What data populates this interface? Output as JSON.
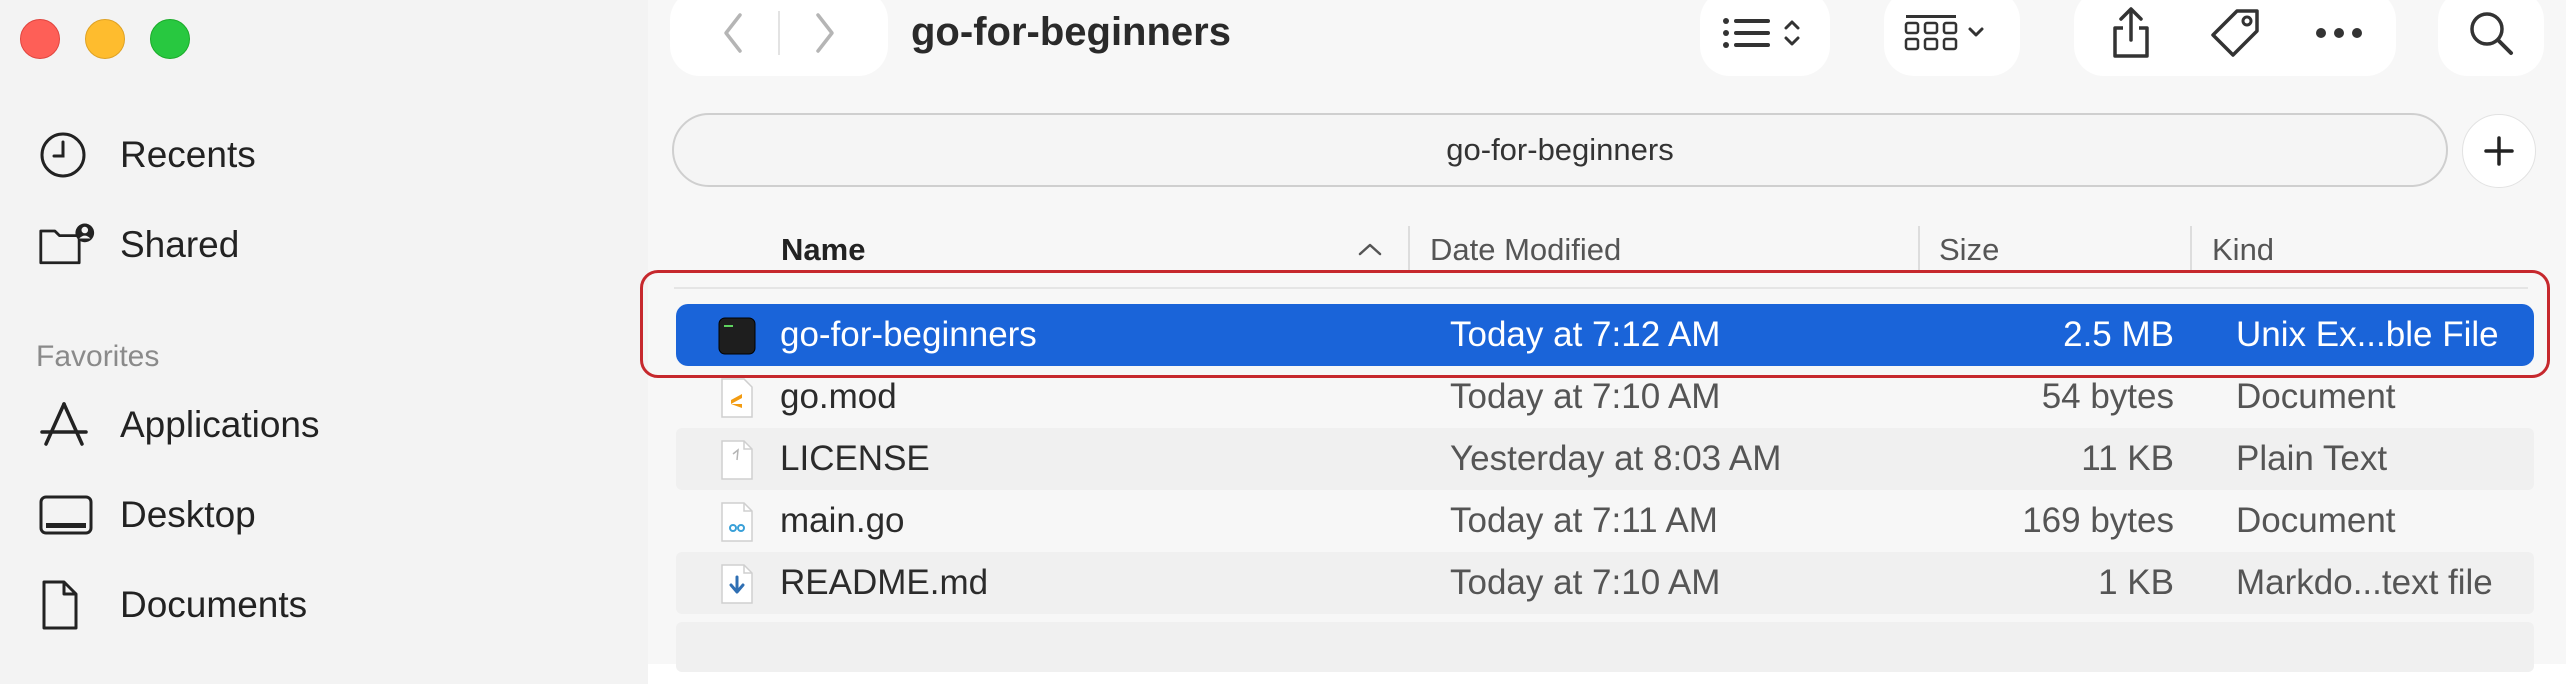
{
  "window": {
    "title": "go-for-beginners"
  },
  "colors": {
    "selection": "#1a64d9",
    "highlight_outline": "#c6282d",
    "close": "#fe5f57",
    "minimize": "#febc2e",
    "zoom": "#28c840"
  },
  "sidebar": {
    "items_top": [
      {
        "label": "Recents",
        "icon": "clock-icon"
      },
      {
        "label": "Shared",
        "icon": "shared-folder-icon"
      }
    ],
    "favorites_heading": "Favorites",
    "favorites": [
      {
        "label": "Applications",
        "icon": "applications-icon"
      },
      {
        "label": "Desktop",
        "icon": "desktop-icon"
      },
      {
        "label": "Documents",
        "icon": "document-icon"
      }
    ]
  },
  "pathbar": {
    "label": "go-for-beginners"
  },
  "columns": {
    "name": "Name",
    "date": "Date Modified",
    "size": "Size",
    "kind": "Kind"
  },
  "files": [
    {
      "name": "go-for-beginners",
      "date": "Today at 7:12 AM",
      "size": "2.5 MB",
      "kind": "Unix Ex...ble File",
      "icon": "terminal-exec-icon",
      "selected": true
    },
    {
      "name": "go.mod",
      "date": "Today at 7:10 AM",
      "size": "54 bytes",
      "kind": "Document",
      "icon": "sublime-doc-icon"
    },
    {
      "name": "LICENSE",
      "date": "Yesterday at 8:03 AM",
      "size": "11 KB",
      "kind": "Plain Text",
      "icon": "plain-text-icon"
    },
    {
      "name": "main.go",
      "date": "Today at 7:11 AM",
      "size": "169 bytes",
      "kind": "Document",
      "icon": "go-file-icon"
    },
    {
      "name": "README.md",
      "date": "Today at 7:10 AM",
      "size": "1 KB",
      "kind": "Markdo...text file",
      "icon": "markdown-file-icon"
    }
  ]
}
